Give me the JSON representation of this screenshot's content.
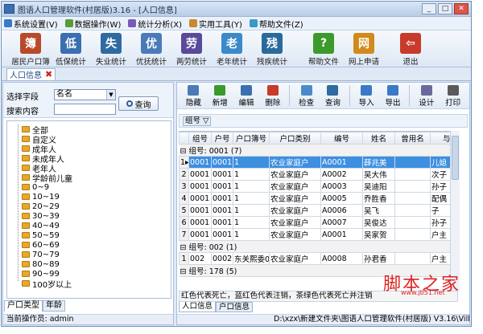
{
  "window": {
    "title": "图语人口管理软件(村居版)3.16 - [人口信息]",
    "min": "_",
    "max": "□",
    "close": "✕"
  },
  "menu": [
    {
      "label": "系统设置(V)",
      "color": "#3a78c8"
    },
    {
      "label": "数据操作(W)",
      "color": "#5a9b38"
    },
    {
      "label": "统计分析(X)",
      "color": "#7a59b8"
    },
    {
      "label": "实用工具(Y)",
      "color": "#c88a2a"
    },
    {
      "label": "帮助文件(Z)",
      "color": "#3a9ac8"
    }
  ],
  "toolbar": [
    {
      "label": "居民户口簿",
      "color": "#b84a2a",
      "glyph": "簿",
      "icon": "household-book-icon"
    },
    {
      "label": "低保统计",
      "color": "#3a6fb0",
      "glyph": "低",
      "icon": "person-icon"
    },
    {
      "label": "失业统计",
      "color": "#2f6aa0",
      "glyph": "失",
      "icon": "person-icon"
    },
    {
      "label": "优抚统计",
      "color": "#4a7ab8",
      "glyph": "优",
      "icon": "person-icon"
    },
    {
      "label": "两劳统计",
      "color": "#5a4a9a",
      "glyph": "劳",
      "icon": "person-icon"
    },
    {
      "label": "老年统计",
      "color": "#3a8ac8",
      "glyph": "老",
      "icon": "person-icon"
    },
    {
      "label": "残疾统计",
      "color": "#2a6a9a",
      "glyph": "残",
      "icon": "person-icon"
    },
    {
      "label": "帮助文件",
      "color": "#3c9a2c",
      "glyph": "?",
      "icon": "help-icon"
    },
    {
      "label": "网上申请",
      "color": "#d28a1a",
      "glyph": "网",
      "icon": "web-icon"
    },
    {
      "label": "退出",
      "color": "#c83a2a",
      "glyph": "⇦",
      "icon": "exit-icon"
    }
  ],
  "doctab": {
    "label": "人口信息"
  },
  "search": {
    "field_label": "选择字段",
    "field_value": "名名",
    "content_label": "搜索内容",
    "content_value": "",
    "query_label": "查询"
  },
  "tree": [
    "全部",
    "自定义",
    "成年人",
    "未成年人",
    "老年人",
    "学龄前儿童",
    "0~9",
    "10~19",
    "20~29",
    "30~39",
    "40~49",
    "50~59",
    "60~69",
    "70~79",
    "80~89",
    "90~99",
    "100岁以上"
  ],
  "left_tabs": [
    "户口类型",
    "年龄"
  ],
  "left_status": "当前操作员: admin",
  "grid_toolbar": [
    {
      "label": "隐藏",
      "color": "#4a7ab8"
    },
    {
      "label": "新增",
      "color": "#3c9a2c"
    },
    {
      "label": "编辑",
      "color": "#3a6fb0"
    },
    {
      "label": "删除",
      "color": "#c83a2a"
    },
    {
      "label": "检查",
      "color": "#4a8ac8"
    },
    {
      "label": "查询",
      "color": "#2f6aa0"
    },
    {
      "label": "导入",
      "color": "#3a78c8"
    },
    {
      "label": "导出",
      "color": "#3a78c8"
    },
    {
      "label": "设计",
      "color": "#6a6a9a"
    },
    {
      "label": "打印",
      "color": "#5a5a5a"
    }
  ],
  "group_by_chip": "组号 ▽",
  "columns": [
    "",
    "组号",
    "户号",
    "户口簿号",
    "户口类别",
    "编号",
    "姓名",
    "曾用名",
    "与户"
  ],
  "group1": "组号: 0001 (7)",
  "rows1": [
    [
      "0001",
      "0001",
      "1",
      "农业家庭户",
      "A0001",
      "薛兆美",
      "",
      "儿媳"
    ],
    [
      "0001",
      "0001",
      "1",
      "农业家庭户",
      "A0002",
      "吴大伟",
      "",
      "次子"
    ],
    [
      "0001",
      "0001",
      "1",
      "农业家庭户",
      "A0003",
      "吴迪阳",
      "",
      "孙子"
    ],
    [
      "0001",
      "0001",
      "1",
      "农业家庭户",
      "A0005",
      "乔胜香",
      "",
      "配偶"
    ],
    [
      "0001",
      "0001",
      "1",
      "农业家庭户",
      "A0006",
      "吴飞",
      "",
      "子"
    ],
    [
      "0001",
      "0001",
      "1",
      "农业家庭户",
      "A0007",
      "吴俊达",
      "",
      "孙子"
    ],
    [
      "0001",
      "0001",
      "1",
      "农业家庭户",
      "A0001",
      "吴家贺",
      "",
      "户主"
    ]
  ],
  "row_numbers": [
    "1",
    "2",
    "3",
    "4",
    "5",
    "6",
    "7",
    "1"
  ],
  "group2": "组号: 002 (1)",
  "rows2": [
    [
      "002",
      "0002",
      "东关熙委002",
      "农业家庭户",
      "A0008",
      "孙君香",
      "",
      "户主"
    ]
  ],
  "group3": "组号: 178 (5)",
  "footer_note": "红色代表死亡，蓝红色代表注销，茶绿色代表死亡并注销",
  "right_tabs": [
    "人口信息",
    "户口信息"
  ],
  "right_status": "D:\\xzx\\新建文件夹\\图语人口管理软件(村居版) V3.16\\Vill...",
  "watermark": "脚本之家",
  "watermark_url": "www.jb51.net"
}
